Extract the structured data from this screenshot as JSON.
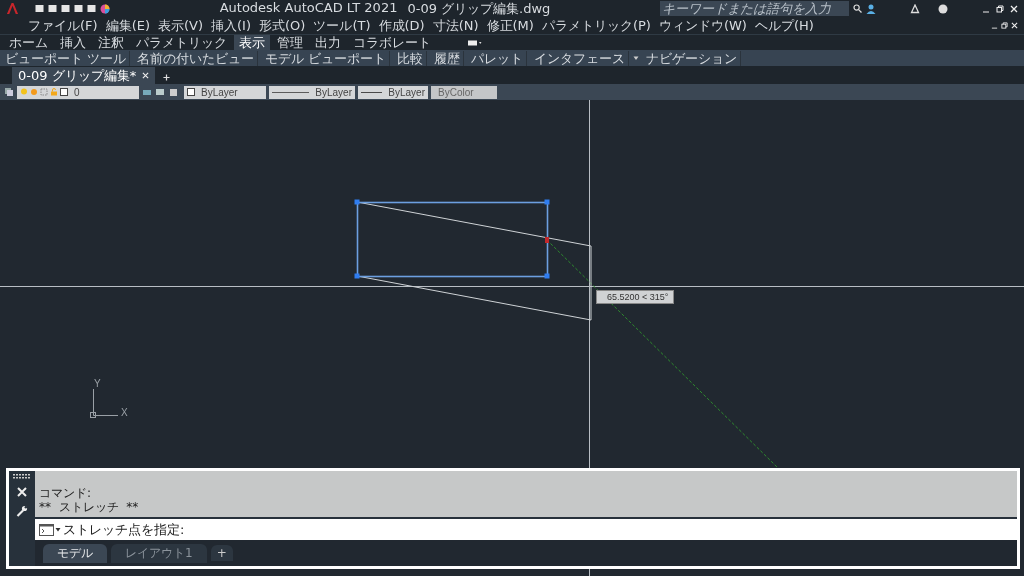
{
  "title_bar": {
    "app_title": "Autodesk AutoCAD LT 2021",
    "document": "0-09 グリップ編集.dwg",
    "search": {
      "placeholder": "キーワードまたは語句を入力"
    }
  },
  "menu_bar": [
    "ファイル(F)",
    "編集(E)",
    "表示(V)",
    "挿入(I)",
    "形式(O)",
    "ツール(T)",
    "作成(D)",
    "寸法(N)",
    "修正(M)",
    "パラメトリック(P)",
    "ウィンドウ(W)",
    "ヘルプ(H)"
  ],
  "ribbon_tabs": [
    {
      "label": "ホーム",
      "selected": false
    },
    {
      "label": "挿入",
      "selected": false
    },
    {
      "label": "注釈",
      "selected": false
    },
    {
      "label": "パラメトリック",
      "selected": false
    },
    {
      "label": "表示",
      "selected": true
    },
    {
      "label": "管理",
      "selected": false
    },
    {
      "label": "出力",
      "selected": false
    },
    {
      "label": "コラボレート",
      "selected": false
    }
  ],
  "ribbon_panels": [
    "ビューポート ツール",
    "名前の付いたビュー",
    "モデル ビューポート",
    "比較",
    "履歴",
    "パレット",
    "インタフェース",
    "ナビゲーション"
  ],
  "document_tabs": [
    {
      "label": "0-09 グリップ編集*",
      "selected": true
    }
  ],
  "properties_toolbar": {
    "layer": "0",
    "color_setting": "ByLayer",
    "linetype": "ByLayer",
    "lineweight": "ByLayer",
    "plot_style": "ByColor"
  },
  "drawing": {
    "tooltip": "65.5200 < 315°",
    "ucs_x": "X",
    "ucs_y": "Y"
  },
  "command_line": {
    "history": [
      "コマンド:",
      "**  ストレッチ  **"
    ],
    "prompt": "ストレッチ点を指定:"
  },
  "layout_tabs": [
    {
      "label": "モデル",
      "selected": true
    },
    {
      "label": "レイアウト1",
      "selected": false
    }
  ],
  "add_tab_label": "+"
}
